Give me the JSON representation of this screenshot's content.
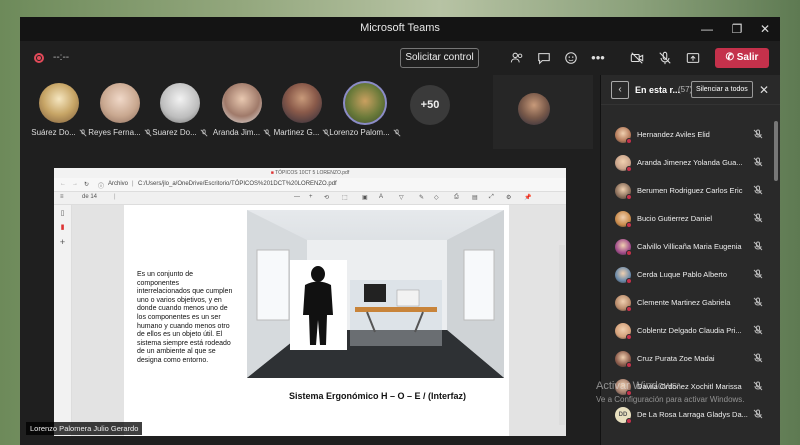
{
  "window": {
    "title": "Microsoft Teams",
    "controls": [
      "minimize",
      "maximize",
      "close"
    ]
  },
  "toolbar": {
    "timer": "--:--",
    "request_control_label": "Solicitar control",
    "icons": [
      "people-icon",
      "chat-icon",
      "reactions-icon",
      "more-icon",
      "camera-off-icon",
      "mic-off-icon",
      "share-icon"
    ],
    "leave_label": "Salir",
    "accent": "#c4314b"
  },
  "tiles": [
    {
      "name": "Suárez Do..."
    },
    {
      "name": "Reyes Ferna..."
    },
    {
      "name": "Suarez Do..."
    },
    {
      "name": "Aranda Jim..."
    },
    {
      "name": "Martinez G..."
    },
    {
      "name": "Lorenzo Palom..."
    }
  ],
  "more_participants": "+50",
  "shared_screen": {
    "tab_title": "TÓPICOS 10CT 5 LORENZO.pdf",
    "address_label": "Archivo",
    "address": "C:/Users/jlo_a/OneDrive/Escritorio/TÓPICOS%201DCT%20LORENZO.pdf",
    "page_of": "de 14",
    "body_text": "Es un conjunto de componentes interrelacionados que cumplen uno o varios objetivos, y en donde cuando menos uno de los componentes es un ser humano y cuando menos otro de ellos es un objeto útil. El sistema siempre está rodeado de un ambiente al que se designa como entorno.",
    "caption": "Sistema Ergonómico H – O – E  /  (Interfaz)"
  },
  "presenter_name": "Lorenzo Palomera Julio Gerardo",
  "panel": {
    "title": "En esta r...",
    "count": "(57)",
    "mute_all_label": "Silenciar a todos",
    "participants": [
      {
        "name": "Hernandez Aviles Elid",
        "color": "#b47a5a"
      },
      {
        "name": "Aranda Jimenez Yolanda Gua...",
        "color": "#c9a38a"
      },
      {
        "name": "Berumen Rodriguez Carlos Eric",
        "color": "#8a6e5a"
      },
      {
        "name": "Bucio Gutierrez Daniel",
        "color": "#c98a4a"
      },
      {
        "name": "Calvillo Villicaña Maria Eugenia",
        "color": "#a04a8a"
      },
      {
        "name": "Cerda Luque Pablo Alberto",
        "color": "#6a8aaa"
      },
      {
        "name": "Clemente Martinez Gabriela",
        "color": "#b88a6a"
      },
      {
        "name": "Coblentz Delgado Claudia Pri...",
        "color": "#d4a07a"
      },
      {
        "name": "Cruz Purata Zoe Madai",
        "color": "#8a5a4a"
      },
      {
        "name": "Davila Ordoñez Xochitl Marissa",
        "color": "#a07a6a"
      },
      {
        "name": "De La Rosa Larraga Gladys Da...",
        "color": "#e8e0c0",
        "initials": "DD"
      }
    ]
  },
  "watermark": {
    "line1": "Activar Windows",
    "line2": "Ve a Configuración para activar Windows."
  }
}
